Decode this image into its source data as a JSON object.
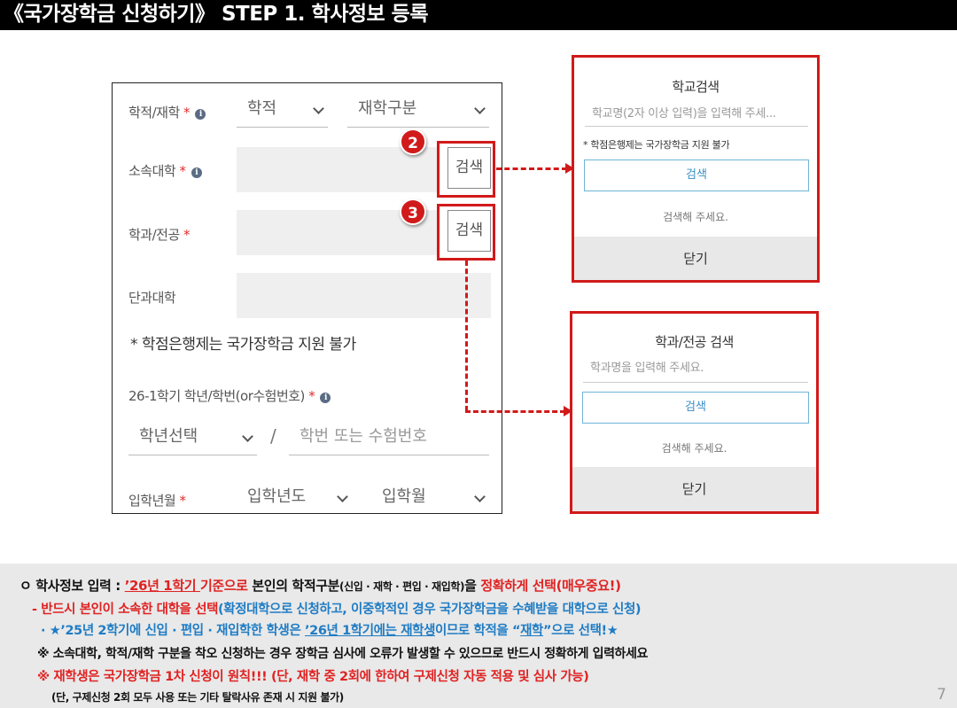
{
  "header": {
    "title": "《국가장학금 신청하기》 STEP 1. 학사정보 등록"
  },
  "form": {
    "status_label": "학적/재학",
    "req_mark": "*",
    "info_glyph": "i",
    "status_select": "학적",
    "enroll_select": "재학구분",
    "university_label": "소속대학",
    "search_label": "검색",
    "major_label": "학과/전공",
    "college_label": "단과대학",
    "credit_bank_note": "* 학점은행제는 국가장학금 지원 불가",
    "grade_label": "26-1학기 학년/학번(or수험번호)",
    "grade_select": "학년선택",
    "slash": "/",
    "student_id_placeholder": "학번 또는 수험번호",
    "admission_label": "입학년월",
    "admission_year": "입학년도",
    "admission_month": "입학월"
  },
  "badges": {
    "two": "2",
    "three": "3"
  },
  "school_modal": {
    "title": "학교검색",
    "placeholder": "학교명(2자 이상 입력)을 입력해 주세...",
    "note": "* 학점은행제는 국가장학금 지원 불가",
    "search_button": "검색",
    "empty_text": "검색해 주세요.",
    "close_button": "닫기"
  },
  "major_modal": {
    "title": "학과/전공 검색",
    "placeholder": "학과명을 입력해 주세요.",
    "search_button": "검색",
    "empty_text": "검색해 주세요.",
    "close_button": "닫기"
  },
  "instructions": {
    "line1": {
      "a": "ㅇ 학사정보 입력 : ",
      "b": "’26년 1학기 ",
      "c": "기준으로 ",
      "d": "본인의 학적구분",
      "e": "(신입 · 재학 · 편입 · 재입학)",
      "f": "을 ",
      "g": "정확하게 선택(매우중요!)"
    },
    "line2": {
      "a": "- 반드시 본인이 소속한 대학을 선택",
      "b": "(확정대학으로 신청하고, 이중학적인 경우 국가장학금을 수혜받을 대학으로 신청)"
    },
    "line3": {
      "a": "· ★’25년 2학기에 신입 · 편입 · 재입학한 학생은 ",
      "b": "’26년 1학기에는 재학생",
      "c": "이므로 학적을 “",
      "d": "재학",
      "e": "”으로 선택!★"
    },
    "line4": "※ 소속대학, 학적/재학 구분을 착오 신청하는 경우 장학금 심사에 오류가 발생할 수 있으므로 반드시 정확하게 입력하세요",
    "line5": "※ 재학생은 국가장학금 1차 신청이 원칙!!! (단, 재학 중 2회에 한하여 구제신청 자동 적용 및 심사 가능)",
    "line6": "(단, 구제신청 2회 모두 사용 또는 기타 탈락사유 존재 시 지원 불가)"
  },
  "page_number": "7"
}
